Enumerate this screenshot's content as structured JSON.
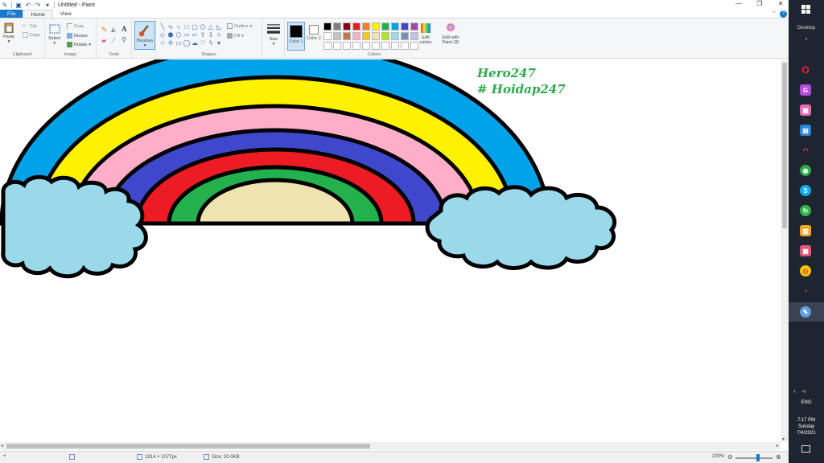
{
  "window": {
    "title": "Untitled - Paint",
    "controls": [
      "—",
      "❐",
      "✕"
    ]
  },
  "menu": {
    "tabs": [
      "File",
      "Home",
      "View"
    ],
    "active": "Home"
  },
  "ribbon": {
    "clipboard": {
      "paste": "Paste",
      "cut": "Cut",
      "copy": "Copy",
      "label": "Clipboard"
    },
    "image": {
      "select": "Select",
      "crop": "Crop",
      "resize": "Resize",
      "rotate": "Rotate",
      "label": "Image"
    },
    "tools": {
      "label": "Tools",
      "text_tool": "A"
    },
    "brushes": {
      "label": "Brushes"
    },
    "shapes": {
      "label": "Shapes",
      "outline": "Outline",
      "fill": "Fill"
    },
    "size": {
      "label": "Size"
    },
    "color1": {
      "label": "Color 1",
      "value": "#000000"
    },
    "color2": {
      "label": "Color 2",
      "value": "#ffffff"
    },
    "colors_group_label": "Colors",
    "edit_colors": "Edit colors",
    "edit_paint3d": "Edit with Paint 3D",
    "palette": [
      "#000000",
      "#7f7f7f",
      "#880015",
      "#ed1c24",
      "#ff7f27",
      "#fff200",
      "#22b14c",
      "#00a2e8",
      "#3f48cc",
      "#a349a4",
      "#ffffff",
      "#c3c3c3",
      "#b97a57",
      "#ffaec9",
      "#ffc90e",
      "#efe4b0",
      "#b5e61d",
      "#99d9ea",
      "#7092be",
      "#c8bfe7",
      "#ffffff",
      "#ffffff",
      "#ffffff",
      "#ffffff",
      "#ffffff",
      "#ffffff",
      "#ffffff",
      "#ffffff",
      "#ffffff",
      "#ffffff"
    ]
  },
  "canvas": {
    "watermark_line1": "Hero247",
    "watermark_line2": "# Hoidap247",
    "bands": [
      {
        "name": "blue",
        "color": "#00a2e8"
      },
      {
        "name": "yellow",
        "color": "#fff200"
      },
      {
        "name": "pink",
        "color": "#ffaec9"
      },
      {
        "name": "indigo",
        "color": "#3f48cc"
      },
      {
        "name": "red",
        "color": "#ed1c24"
      },
      {
        "name": "green",
        "color": "#22b14c"
      },
      {
        "name": "cream",
        "color": "#efe4b0"
      }
    ],
    "cloud_color": "#99d9ea"
  },
  "statusbar": {
    "dimensions": "1914 × 1077px",
    "size": "Size: 20.0KB",
    "zoom": "200%",
    "zoom_level_percent": 200
  },
  "taskbar": {
    "desktop_label": "Desktop",
    "lang": "ENG",
    "time": "7:17 PM",
    "day": "Sunday",
    "date": "7/4/2021"
  }
}
